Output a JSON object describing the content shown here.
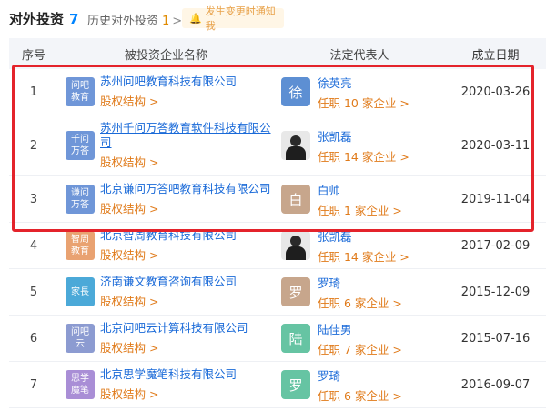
{
  "header": {
    "title": "对外投资",
    "title_count": "7",
    "history_label": "历史对外投资",
    "history_count": "1",
    "chevron": ">",
    "notify_label": "发生变更时通知我"
  },
  "table": {
    "headers": {
      "idx": "序号",
      "company": "被投资企业名称",
      "rep": "法定代表人",
      "date": "成立日期"
    },
    "rows": [
      {
        "idx": "1",
        "logo_text": "问吧\n教育",
        "logo_color": "#6f96d8",
        "company": "苏州问吧教育科技有限公司",
        "equity": "股权结构 >",
        "avatar_text": "徐",
        "avatar_color": "#5d8fd3",
        "rep": "徐英亮",
        "rep_sub": "任职 10 家企业 >",
        "date": "2020-03-26"
      },
      {
        "idx": "2",
        "logo_text": "千问\n万答",
        "logo_color": "#6f96d8",
        "company": "苏州千问万答教育软件科技有限公司",
        "equity": "股权结构 >",
        "avatar_text": "",
        "avatar_color": "#e8e8e8",
        "rep": "张凯磊",
        "rep_sub": "任职 14 家企业 >",
        "date": "2020-03-11"
      },
      {
        "idx": "3",
        "logo_text": "谦问\n万答",
        "logo_color": "#6f96d8",
        "company": "北京谦问万答吧教育科技有限公司",
        "equity": "股权结构 >",
        "avatar_text": "白",
        "avatar_color": "#c7a68c",
        "rep": "白帅",
        "rep_sub": "任职 1 家企业 >",
        "date": "2019-11-04"
      },
      {
        "idx": "4",
        "logo_text": "智周\n教育",
        "logo_color": "#e9a271",
        "company": "北京智周教育科技有限公司",
        "equity": "股权结构 >",
        "avatar_text": "",
        "avatar_color": "#e8e8e8",
        "rep": "张凯磊",
        "rep_sub": "任职 14 家企业 >",
        "date": "2017-02-09"
      },
      {
        "idx": "5",
        "logo_text": "家長",
        "logo_color": "#4ba9d8",
        "company": "济南谦文教育咨询有限公司",
        "equity": "股权结构 >",
        "avatar_text": "罗",
        "avatar_color": "#c7a68c",
        "rep": "罗琦",
        "rep_sub": "任职 6 家企业 >",
        "date": "2015-12-09"
      },
      {
        "idx": "6",
        "logo_text": "问吧\n云",
        "logo_color": "#8c9bd1",
        "company": "北京问吧云计算科技有限公司",
        "equity": "股权结构 >",
        "avatar_text": "陆",
        "avatar_color": "#66c4a3",
        "rep": "陆佳男",
        "rep_sub": "任职 7 家企业 >",
        "date": "2015-07-16"
      },
      {
        "idx": "7",
        "logo_text": "思学\n魔笔",
        "logo_color": "#a98ed6",
        "company": "北京思学魔笔科技有限公司",
        "equity": "股权结构 >",
        "avatar_text": "罗",
        "avatar_color": "#66c4a3",
        "rep": "罗琦",
        "rep_sub": "任职 6 家企业 >",
        "date": "2016-09-07"
      }
    ]
  },
  "colors": {
    "accent": "#0084ff",
    "link": "#1a6ad8",
    "orange": "#e07b1b",
    "highlight": "#e4232b"
  },
  "icons": {
    "notify": "bell-icon"
  }
}
